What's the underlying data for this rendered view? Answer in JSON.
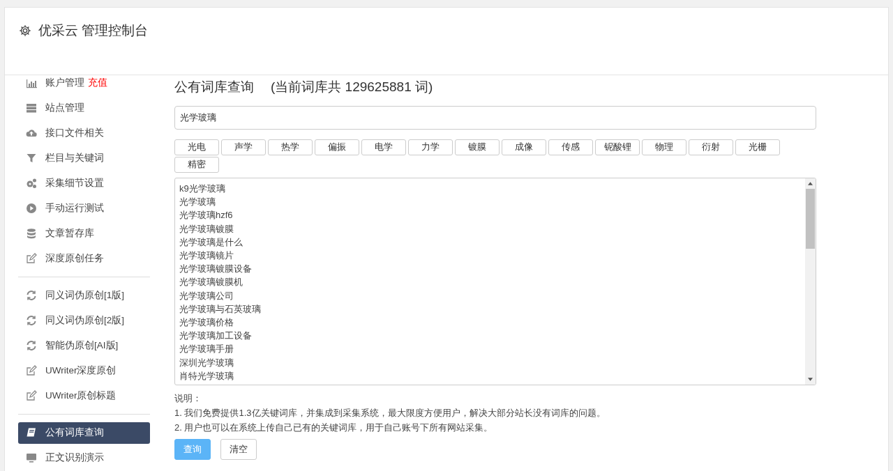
{
  "header": {
    "title": "优采云 管理控制台"
  },
  "sidebar": {
    "groups": [
      {
        "items": [
          {
            "label": "账户管理",
            "badge": "充值",
            "selected": false
          },
          {
            "label": "站点管理",
            "selected": false
          },
          {
            "label": "接口文件相关",
            "selected": false
          },
          {
            "label": "栏目与关键词",
            "selected": false
          },
          {
            "label": "采集细节设置",
            "selected": false
          },
          {
            "label": "手动运行测试",
            "selected": false
          },
          {
            "label": "文章暂存库",
            "selected": false
          },
          {
            "label": "深度原创任务",
            "selected": false
          }
        ]
      },
      {
        "items": [
          {
            "label": "同义词伪原创[1版]",
            "selected": false
          },
          {
            "label": "同义词伪原创[2版]",
            "selected": false
          },
          {
            "label": "智能伪原创[AI版]",
            "selected": false
          },
          {
            "label": "UWriter深度原创",
            "selected": false
          },
          {
            "label": "UWriter原创标题",
            "selected": false
          }
        ]
      },
      {
        "items": [
          {
            "label": "公有词库查询",
            "selected": true
          },
          {
            "label": "正文识别演示",
            "selected": false
          }
        ]
      }
    ]
  },
  "main": {
    "title": "公有词库查询",
    "count_note": "(当前词库共 129625881 词)",
    "search": {
      "value": "光学玻璃"
    },
    "tags": [
      "光电",
      "声学",
      "热学",
      "偏振",
      "电学",
      "力学",
      "镀膜",
      "成像",
      "传感",
      "铌酸锂",
      "物理",
      "衍射",
      "光栅",
      "精密"
    ],
    "results": [
      "k9光学玻璃",
      "光学玻璃",
      "光学玻璃hzf6",
      "光学玻璃镀膜",
      "光学玻璃是什么",
      "光学玻璃镜片",
      "光学玻璃镀膜设备",
      "光学玻璃镀膜机",
      "光学玻璃公司",
      "光学玻璃与石英玻璃",
      "光学玻璃价格",
      "光学玻璃加工设备",
      "光学玻璃手册",
      "深圳光学玻璃",
      "肖特光学玻璃"
    ],
    "notes": {
      "heading": "说明：",
      "lines": [
        "1. 我们免费提供1.3亿关键词库，并集成到采集系统，最大限度方便用户，解决大部分站长没有词库的问题。",
        "2. 用户也可以在系统上传自己已有的关键词库，用于自己账号下所有网站采集。"
      ]
    },
    "buttons": [
      {
        "label": "查询",
        "kind": "primary"
      },
      {
        "label": "清空",
        "kind": "default"
      }
    ]
  }
}
